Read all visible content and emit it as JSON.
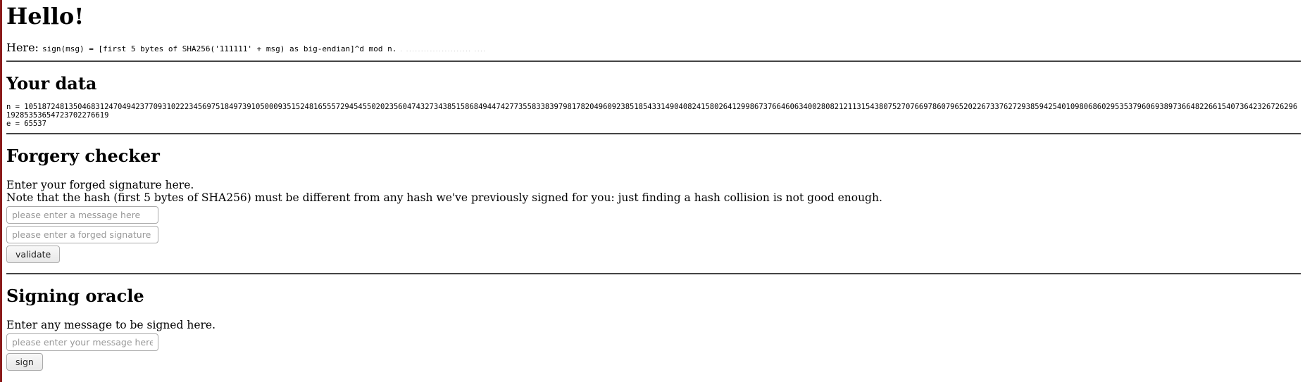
{
  "heading": "Hello!",
  "intro": {
    "label": "Here:",
    "formula": "sign(msg) = [first 5 bytes of SHA256('111111' + msg) as big-endian]^d mod n.",
    "trailing": " . ......................  ...."
  },
  "data_section": {
    "title": "Your data",
    "n_line": "n = 105187248135046831247049423770931022234569751849739105000935152481655572945455020235604743273438515868494474277355833839798178204960923851854331490408241580264129986737664606340028082121131543807527076697860796520226733762729385942540109806860295353796069389736648226615407364232672629619285353654723702276619",
    "e_line": "e = 65537"
  },
  "forgery": {
    "title": "Forgery checker",
    "line1": "Enter your forged signature here.",
    "line2": "Note that the hash (first 5 bytes of SHA256) must be different from any hash we've previously signed for you: just finding a hash collision is not good enough.",
    "message_placeholder": "please enter a message here",
    "signature_placeholder": "please enter a forged signature here",
    "validate_label": "validate"
  },
  "oracle": {
    "title": "Signing oracle",
    "line1": "Enter any message to be signed here.",
    "message_placeholder": "please enter your message here",
    "sign_label": "sign"
  },
  "colors": {
    "left_border": "#8b1a1a",
    "rule": "#444444"
  }
}
